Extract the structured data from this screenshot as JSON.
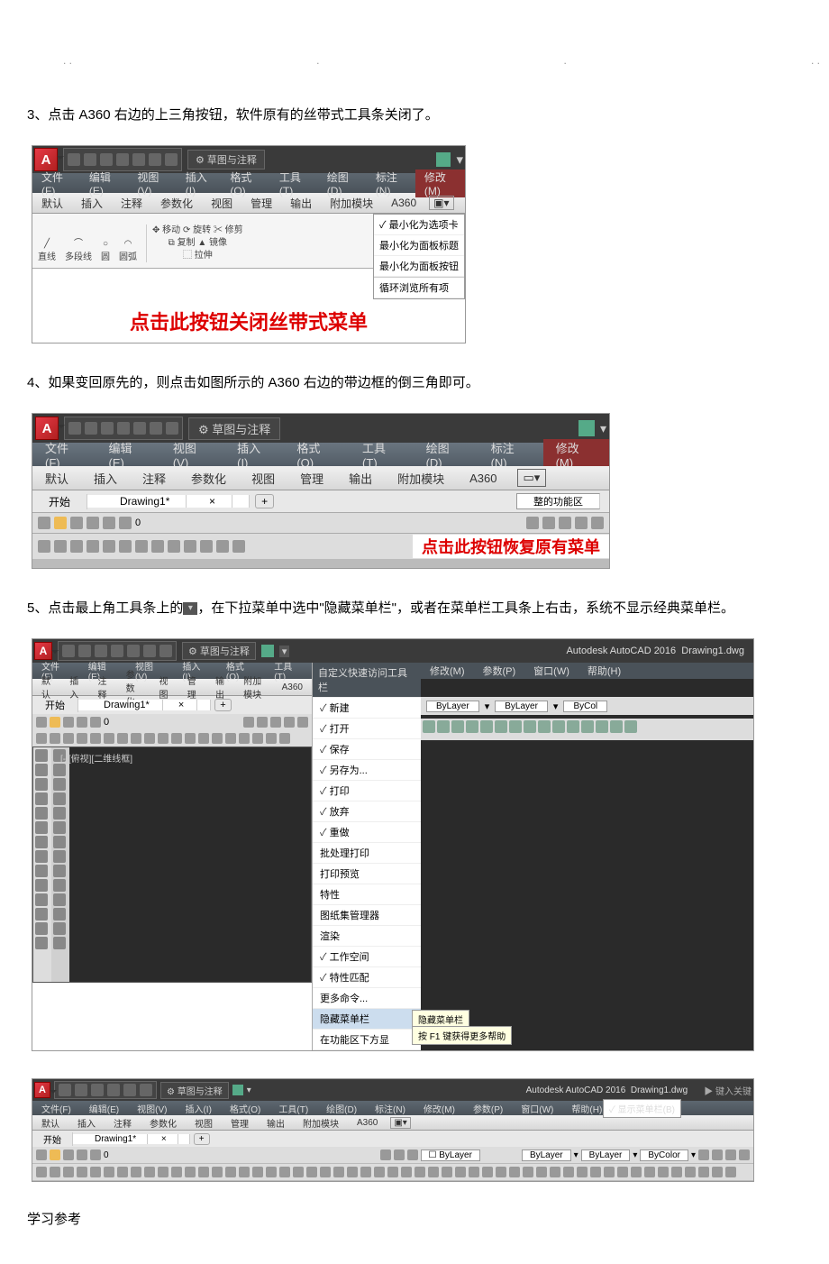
{
  "dots": [
    ". .",
    ".",
    ".",
    ". ."
  ],
  "step3": "3、点击 A360 右边的上三角按钮，软件原有的丝带式工具条关闭了。",
  "step4": "4、如果变回原先的，则点击如图所示的 A360 右边的带边框的倒三角即可。",
  "step5_a": "5、点击最上角工具条上的",
  "step5_b": "，在下拉菜单中选中\"隐藏菜单栏\"，或者在菜单栏工具条上右击，系统不显示经典菜单栏。",
  "footer": "学习参考",
  "ws_label": "草图与注释",
  "app": {
    "title": "Autodesk AutoCAD 2016",
    "doc": "Drawing1.dwg",
    "kw": "键入关键"
  },
  "menus": {
    "file": "文件(F)",
    "edit": "编辑(E)",
    "view": "视图(V)",
    "insert": "插入(I)",
    "format": "格式(O)",
    "tools": "工具(T)",
    "draw": "绘图(D)",
    "dim": "标注(N)",
    "modify": "修改(M)",
    "param": "参数(P)",
    "window": "窗口(W)",
    "help": "帮助(H)"
  },
  "ribtabs": {
    "default": "默认",
    "insert": "插入",
    "annotate": "注释",
    "param": "参数化",
    "view": "视图",
    "manage": "管理",
    "output": "输出",
    "addin": "附加模块",
    "a360": "A360"
  },
  "doctabs": {
    "start": "开始",
    "d1": "Drawing1*",
    "plus": "+",
    "x": "×"
  },
  "fig1": {
    "draw": {
      "line": "直线",
      "polyline": "多段线",
      "circle": "圆",
      "arc": "圆弧"
    },
    "mod": {
      "move": "移动",
      "rotate": "旋转",
      "trim": "修剪",
      "copy": "复制",
      "mirror": "镜像",
      "stretch": "拉伸"
    },
    "menu": {
      "a": "最小化为选项卡",
      "b": "最小化为面板标题",
      "c": "最小化为面板按钮",
      "d": "循环浏览所有项"
    },
    "callout": "点击此按钮关闭丝带式菜单"
  },
  "fig2": {
    "ribnote": "整的功能区",
    "callout": "点击此按钮恢复原有菜单",
    "zero": "0"
  },
  "fig3": {
    "qat_hdr": "自定义快速访问工具栏",
    "viewtag": "[-][俯视][二维线框]",
    "bylayer": "ByLayer",
    "bycol": "ByCol",
    "tip1": "隐藏菜单栏",
    "tip2": "按 F1 键获得更多帮助",
    "items": {
      "new": "新建",
      "open": "打开",
      "save": "保存",
      "saveas": "另存为...",
      "plot": "打印",
      "discard": "放弃",
      "redo": "重做",
      "batch": "批处理打印",
      "preview": "打印预览",
      "props": "特性",
      "sheet": "图纸集管理器",
      "render": "渲染",
      "ws": "工作空间",
      "match": "特性匹配",
      "more": "更多命令...",
      "hidemenu": "隐藏菜单栏",
      "below": "在功能区下方显"
    }
  },
  "fig4": {
    "showmenu": "显示菜单栏(B)",
    "bylayer": "ByLayer",
    "bycolor": "ByColor",
    "zero": "0"
  }
}
